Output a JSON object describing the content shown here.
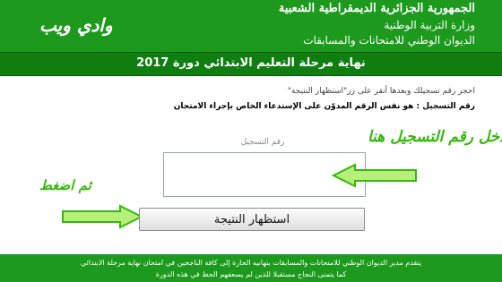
{
  "header": {
    "line1": "الجمهورية الجزائرية الديمقراطية الشعبية",
    "line2": "وزارة التربية الوطنية",
    "line3": "الديوان الوطني للامتحانات والمسابقات",
    "site_name": "وادي ويب"
  },
  "title_bar": {
    "text": "نهاية مرحلة التعليم الابتدائي دورة 2017"
  },
  "instructions": {
    "line1": "احجز رقم تسجيلك وبعدها أنقر على زر\"استظهار النتيجة\"",
    "line2_label": "رقم التسجيل :",
    "line2_text": "هو نفس الرقم المدوّن على الإستدعاء الخاص بإجراء الامتحان"
  },
  "form": {
    "field_label": "رقم التسجيل",
    "input_value": "",
    "submit_label": "استظهار النتيجة"
  },
  "annotations": {
    "enter_number": "أدخل رقم التسجيل هنا",
    "then_press": "ثم اضغط"
  },
  "footer": {
    "line1": "يتقدم مدير الديوان الوطني للامتحانات والمسابقات بتهانيه الحارة إلى كافة الناجحين في امتحان نهاية مرحلة الابتدائي",
    "line2": "كما يتمنى النجاح مستقبلا للذين لم يسعفهم الحظ في هذه الدورة"
  },
  "colors": {
    "header_green": "#1d9a1d",
    "title_green": "#0f7d0f",
    "annotation_green": "#35b80b",
    "arrow_fill": "#b6f07a"
  }
}
